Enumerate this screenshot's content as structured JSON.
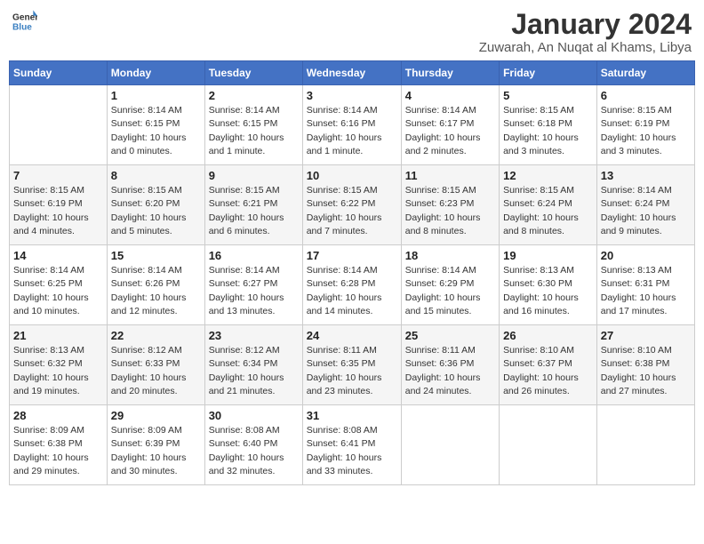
{
  "logo": {
    "general": "General",
    "blue": "Blue"
  },
  "header": {
    "month_year": "January 2024",
    "location": "Zuwarah, An Nuqat al Khams, Libya"
  },
  "days_of_week": [
    "Sunday",
    "Monday",
    "Tuesday",
    "Wednesday",
    "Thursday",
    "Friday",
    "Saturday"
  ],
  "weeks": [
    [
      {
        "day": "",
        "info": ""
      },
      {
        "day": "1",
        "info": "Sunrise: 8:14 AM\nSunset: 6:15 PM\nDaylight: 10 hours\nand 0 minutes."
      },
      {
        "day": "2",
        "info": "Sunrise: 8:14 AM\nSunset: 6:15 PM\nDaylight: 10 hours\nand 1 minute."
      },
      {
        "day": "3",
        "info": "Sunrise: 8:14 AM\nSunset: 6:16 PM\nDaylight: 10 hours\nand 1 minute."
      },
      {
        "day": "4",
        "info": "Sunrise: 8:14 AM\nSunset: 6:17 PM\nDaylight: 10 hours\nand 2 minutes."
      },
      {
        "day": "5",
        "info": "Sunrise: 8:15 AM\nSunset: 6:18 PM\nDaylight: 10 hours\nand 3 minutes."
      },
      {
        "day": "6",
        "info": "Sunrise: 8:15 AM\nSunset: 6:19 PM\nDaylight: 10 hours\nand 3 minutes."
      }
    ],
    [
      {
        "day": "7",
        "info": "Sunrise: 8:15 AM\nSunset: 6:19 PM\nDaylight: 10 hours\nand 4 minutes."
      },
      {
        "day": "8",
        "info": "Sunrise: 8:15 AM\nSunset: 6:20 PM\nDaylight: 10 hours\nand 5 minutes."
      },
      {
        "day": "9",
        "info": "Sunrise: 8:15 AM\nSunset: 6:21 PM\nDaylight: 10 hours\nand 6 minutes."
      },
      {
        "day": "10",
        "info": "Sunrise: 8:15 AM\nSunset: 6:22 PM\nDaylight: 10 hours\nand 7 minutes."
      },
      {
        "day": "11",
        "info": "Sunrise: 8:15 AM\nSunset: 6:23 PM\nDaylight: 10 hours\nand 8 minutes."
      },
      {
        "day": "12",
        "info": "Sunrise: 8:15 AM\nSunset: 6:24 PM\nDaylight: 10 hours\nand 8 minutes."
      },
      {
        "day": "13",
        "info": "Sunrise: 8:14 AM\nSunset: 6:24 PM\nDaylight: 10 hours\nand 9 minutes."
      }
    ],
    [
      {
        "day": "14",
        "info": "Sunrise: 8:14 AM\nSunset: 6:25 PM\nDaylight: 10 hours\nand 10 minutes."
      },
      {
        "day": "15",
        "info": "Sunrise: 8:14 AM\nSunset: 6:26 PM\nDaylight: 10 hours\nand 12 minutes."
      },
      {
        "day": "16",
        "info": "Sunrise: 8:14 AM\nSunset: 6:27 PM\nDaylight: 10 hours\nand 13 minutes."
      },
      {
        "day": "17",
        "info": "Sunrise: 8:14 AM\nSunset: 6:28 PM\nDaylight: 10 hours\nand 14 minutes."
      },
      {
        "day": "18",
        "info": "Sunrise: 8:14 AM\nSunset: 6:29 PM\nDaylight: 10 hours\nand 15 minutes."
      },
      {
        "day": "19",
        "info": "Sunrise: 8:13 AM\nSunset: 6:30 PM\nDaylight: 10 hours\nand 16 minutes."
      },
      {
        "day": "20",
        "info": "Sunrise: 8:13 AM\nSunset: 6:31 PM\nDaylight: 10 hours\nand 17 minutes."
      }
    ],
    [
      {
        "day": "21",
        "info": "Sunrise: 8:13 AM\nSunset: 6:32 PM\nDaylight: 10 hours\nand 19 minutes."
      },
      {
        "day": "22",
        "info": "Sunrise: 8:12 AM\nSunset: 6:33 PM\nDaylight: 10 hours\nand 20 minutes."
      },
      {
        "day": "23",
        "info": "Sunrise: 8:12 AM\nSunset: 6:34 PM\nDaylight: 10 hours\nand 21 minutes."
      },
      {
        "day": "24",
        "info": "Sunrise: 8:11 AM\nSunset: 6:35 PM\nDaylight: 10 hours\nand 23 minutes."
      },
      {
        "day": "25",
        "info": "Sunrise: 8:11 AM\nSunset: 6:36 PM\nDaylight: 10 hours\nand 24 minutes."
      },
      {
        "day": "26",
        "info": "Sunrise: 8:10 AM\nSunset: 6:37 PM\nDaylight: 10 hours\nand 26 minutes."
      },
      {
        "day": "27",
        "info": "Sunrise: 8:10 AM\nSunset: 6:38 PM\nDaylight: 10 hours\nand 27 minutes."
      }
    ],
    [
      {
        "day": "28",
        "info": "Sunrise: 8:09 AM\nSunset: 6:38 PM\nDaylight: 10 hours\nand 29 minutes."
      },
      {
        "day": "29",
        "info": "Sunrise: 8:09 AM\nSunset: 6:39 PM\nDaylight: 10 hours\nand 30 minutes."
      },
      {
        "day": "30",
        "info": "Sunrise: 8:08 AM\nSunset: 6:40 PM\nDaylight: 10 hours\nand 32 minutes."
      },
      {
        "day": "31",
        "info": "Sunrise: 8:08 AM\nSunset: 6:41 PM\nDaylight: 10 hours\nand 33 minutes."
      },
      {
        "day": "",
        "info": ""
      },
      {
        "day": "",
        "info": ""
      },
      {
        "day": "",
        "info": ""
      }
    ]
  ]
}
